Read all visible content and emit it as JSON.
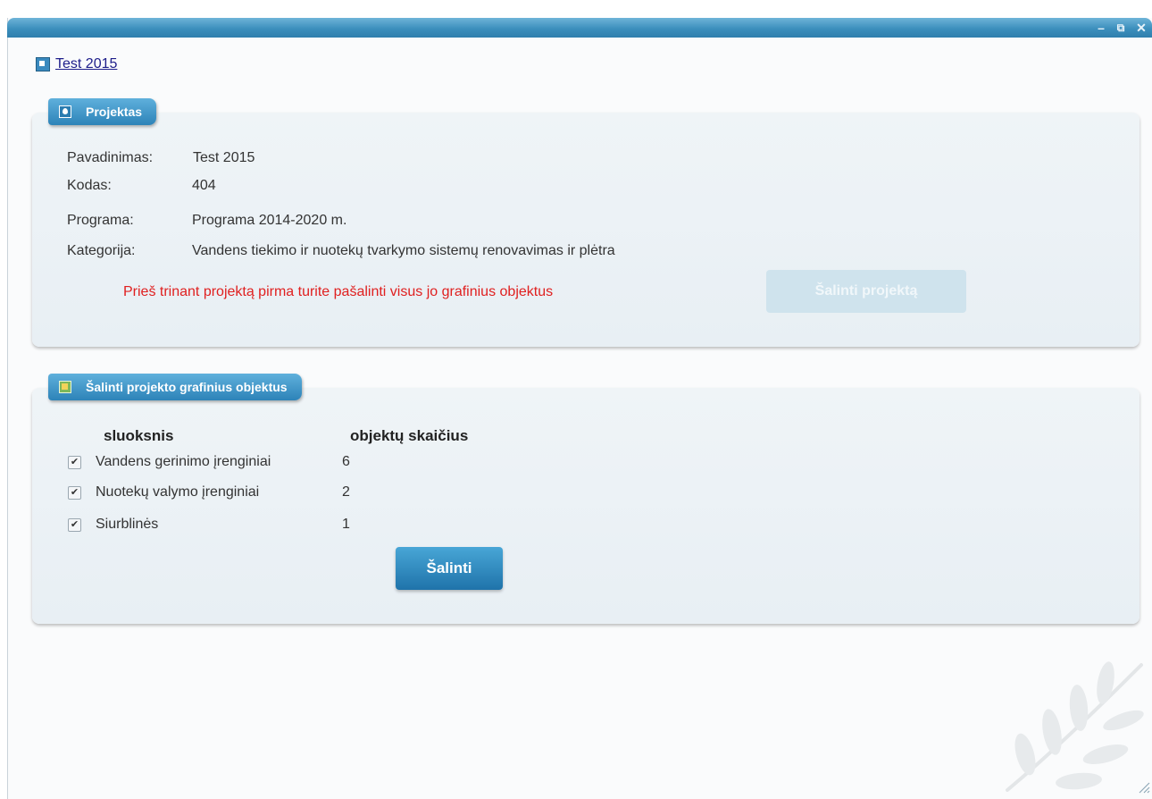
{
  "window": {
    "controls": {
      "minimize": "–",
      "restore": "⧉",
      "close": "✕"
    }
  },
  "project_link": {
    "label": "Test 2015"
  },
  "project_panel": {
    "title": "Projektas",
    "fields": [
      {
        "label": "Pavadinimas:",
        "value": "Test 2015"
      },
      {
        "label": "Kodas:",
        "value": "404"
      },
      {
        "label": "Programa:",
        "value": "Programa 2014-2020 m."
      },
      {
        "label": "Kategorija:",
        "value": "Vandens tiekimo ir nuotekų tvarkymo sistemų renovavimas ir plėtra"
      }
    ],
    "warning": "Prieš trinant projektą pirma turite pašalinti visus jo grafinius objektus",
    "delete_button": "Šalinti projektą"
  },
  "objects_panel": {
    "title": "Šalinti projekto grafinius objektus",
    "headers": {
      "layer": "sluoksnis",
      "count": "objektų skaičius"
    },
    "rows": [
      {
        "name": "Vandens gerinimo įrenginiai",
        "count": "6",
        "checked": true
      },
      {
        "name": "Nuotekų valymo įrenginiai",
        "count": "2",
        "checked": true
      },
      {
        "name": "Siurblinės",
        "count": "1",
        "checked": true
      }
    ],
    "delete_button": "Šalinti"
  },
  "colors": {
    "accent": "#2d83b8",
    "warning": "#e02020",
    "link": "#1d1d8a"
  }
}
